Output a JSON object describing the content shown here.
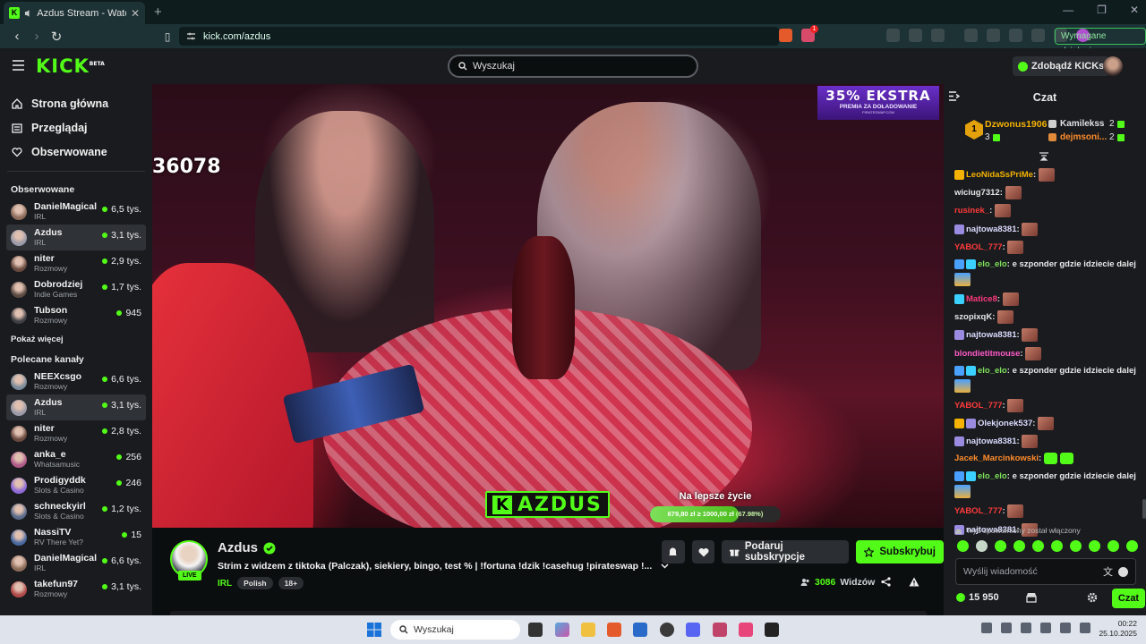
{
  "browser": {
    "tab_title": "Azdus Stream - Watch Live o",
    "tab_favicon_letter": "K",
    "url": "kick.com/azdus",
    "action_button": "Wymagane działanie",
    "ext_badge": "1"
  },
  "header": {
    "logo": "KICK",
    "logo_badge": "BETA",
    "search_placeholder": "Wyszukaj",
    "get_kicks": "Zdobądź KICKs"
  },
  "sidebar": {
    "nav": [
      {
        "label": "Strona główna",
        "icon": "home-icon"
      },
      {
        "label": "Przeglądaj",
        "icon": "browse-icon"
      },
      {
        "label": "Obserwowane",
        "icon": "heart-icon"
      }
    ],
    "followed_title": "Obserwowane",
    "followed": [
      {
        "name": "DanielMagical",
        "category": "IRL",
        "viewers": "6,5 tys.",
        "color": "#8c6b5a",
        "active": false
      },
      {
        "name": "Azdus",
        "category": "IRL",
        "viewers": "3,1 tys.",
        "color": "#9a9aa8",
        "active": true
      },
      {
        "name": "niter",
        "category": "Rozmowy",
        "viewers": "2,9 tys.",
        "color": "#6a4a3f",
        "active": false
      },
      {
        "name": "Dobrodziej",
        "category": "Indie Games",
        "viewers": "1,7 tys.",
        "color": "#5a4a42",
        "active": false
      },
      {
        "name": "Tubson",
        "category": "Rozmowy",
        "viewers": "945",
        "color": "#3f3f44",
        "active": false
      }
    ],
    "show_more": "Pokaż więcej",
    "recommended_title": "Polecane kanały",
    "recommended": [
      {
        "name": "NEEXcsgo",
        "category": "Rozmowy",
        "viewers": "6,6 tys.",
        "color": "#7a8a99",
        "active": false
      },
      {
        "name": "Azdus",
        "category": "IRL",
        "viewers": "3,1 tys.",
        "color": "#9a9aa8",
        "active": true
      },
      {
        "name": "niter",
        "category": "Rozmowy",
        "viewers": "2,8 tys.",
        "color": "#6a4a3f",
        "active": false
      },
      {
        "name": "anka_e",
        "category": "Whatsamusic",
        "viewers": "256",
        "color": "#b05a8a",
        "active": false
      },
      {
        "name": "Prodigyddk",
        "category": "Slots & Casino",
        "viewers": "246",
        "color": "#8e6ad8",
        "active": false
      },
      {
        "name": "schneckyirl",
        "category": "Slots & Casino",
        "viewers": "1,2 tys.",
        "color": "#5a6a8a",
        "active": false
      },
      {
        "name": "NassiTV",
        "category": "RV There Yet?",
        "viewers": "15",
        "color": "#4a6aa0",
        "active": false
      },
      {
        "name": "DanielMagical",
        "category": "IRL",
        "viewers": "6,6 tys.",
        "color": "#8c6b5a",
        "active": false
      },
      {
        "name": "takefun97",
        "category": "Rozmowy",
        "viewers": "3,1 tys.",
        "color": "#b04a4a",
        "active": false
      }
    ]
  },
  "video": {
    "overlay_number": "36078",
    "promo_big": "35% EKSTRA",
    "promo_small": "PREMIA ZA DOŁADOWANIE",
    "promo_tiny": "PIRATESWAP.COM",
    "brand_k": "K",
    "brand_name": "AZDUS",
    "goal_label": "Na lepsze życie",
    "goal_text": "679,80 zł ≥ 1000,00 zł",
    "goal_percent": "(67.98%)",
    "goal_fraction": 0.6798
  },
  "stream": {
    "live_label": "LIVE",
    "name": "Azdus",
    "title": "Strim z widzem z tiktoka (Palczak), siekiery, bingo, test %  | !fortuna !dzik !casehug !pirateswap !...",
    "category": "IRL",
    "tags": [
      "Polish",
      "18+"
    ],
    "gift_sub": "Podaruj subskrypcje",
    "subscribe": "Subskrybuj",
    "viewers_count": "3086",
    "viewers_label": "Widzów"
  },
  "chat": {
    "title": "Czat",
    "leaderboard": [
      {
        "rank": "1",
        "name": "Dzwonus1906",
        "count": "3"
      },
      {
        "name": "Kamilekss",
        "count": "2"
      },
      {
        "name": "dejmsoni...",
        "count": "2"
      }
    ],
    "messages": [
      {
        "user": "LeoNidaSsPriMe",
        "color": "#f5b300",
        "text": "",
        "emote": true,
        "badges": [
          "#f5b300"
        ]
      },
      {
        "user": "wiciug7312",
        "color": "#e6e6e6",
        "text": "",
        "emote": true,
        "badges": []
      },
      {
        "user": "rusinek_",
        "color": "#ff3a3a",
        "text": "",
        "emote": true,
        "badges": []
      },
      {
        "user": "najtowa8381",
        "color": "#dcdcff",
        "text": "",
        "emote": true,
        "badges": [
          "#9a8ae0"
        ]
      },
      {
        "user": "YABOL_777",
        "color": "#ff3a3a",
        "text": "",
        "emote": true,
        "badges": []
      },
      {
        "user": "elo_elo",
        "color": "#7ee05a",
        "text": "e szponder gdzie idziecie dalej",
        "emote": false,
        "badges": [
          "#4aa0ff",
          "#3ad0ff"
        ],
        "wrap": true
      },
      {
        "user": "Matice8",
        "color": "#ff3a7a",
        "text": "",
        "emote": true,
        "badges": [
          "#3ad0ff"
        ]
      },
      {
        "user": "szopixqK",
        "color": "#e6e6e6",
        "text": "",
        "emote": true,
        "badges": []
      },
      {
        "user": "najtowa8381",
        "color": "#dcdcff",
        "text": "",
        "emote": true,
        "badges": [
          "#9a8ae0"
        ]
      },
      {
        "user": "blondietitmouse",
        "color": "#ff5ac8",
        "text": "",
        "emote": true,
        "badges": []
      },
      {
        "user": "elo_elo",
        "color": "#7ee05a",
        "text": "e szponder gdzie idziecie dalej",
        "emote": false,
        "badges": [
          "#4aa0ff",
          "#3ad0ff"
        ],
        "wrap": true
      },
      {
        "user": "YABOL_777",
        "color": "#ff3a3a",
        "text": "",
        "emote": true,
        "badges": []
      },
      {
        "user": "Olekjonek537",
        "color": "#dcdcff",
        "text": "",
        "emote": true,
        "badges": [
          "#f5b300",
          "#9a8ae0"
        ]
      },
      {
        "user": "najtowa8381",
        "color": "#dcdcff",
        "text": "",
        "emote": true,
        "badges": [
          "#9a8ae0"
        ]
      },
      {
        "user": "Jacek_Marcinkowski",
        "color": "#ff8c2a",
        "text": "",
        "emote": false,
        "green_emotes": 2,
        "badges": []
      },
      {
        "user": "elo_elo",
        "color": "#7ee05a",
        "text": "e szponder gdzie idziecie dalej",
        "emote": false,
        "badges": [
          "#4aa0ff",
          "#3ad0ff"
        ],
        "wrap": true
      },
      {
        "user": "YABOL_777",
        "color": "#ff3a3a",
        "text": "",
        "emote": true,
        "badges": []
      },
      {
        "user": "najtowa8381",
        "color": "#dcdcff",
        "text": "",
        "emote": true,
        "badges": [
          "#9a8ae0"
        ]
      }
    ],
    "slow_mode": "Tryb spowolniony został włączony",
    "input_placeholder": "Wyślij wiadomość",
    "kicks_balance": "15 950",
    "send_button": "Czat"
  },
  "taskbar": {
    "search_placeholder": "Wyszukaj",
    "time": "00:22",
    "date": "25.10.2025"
  }
}
